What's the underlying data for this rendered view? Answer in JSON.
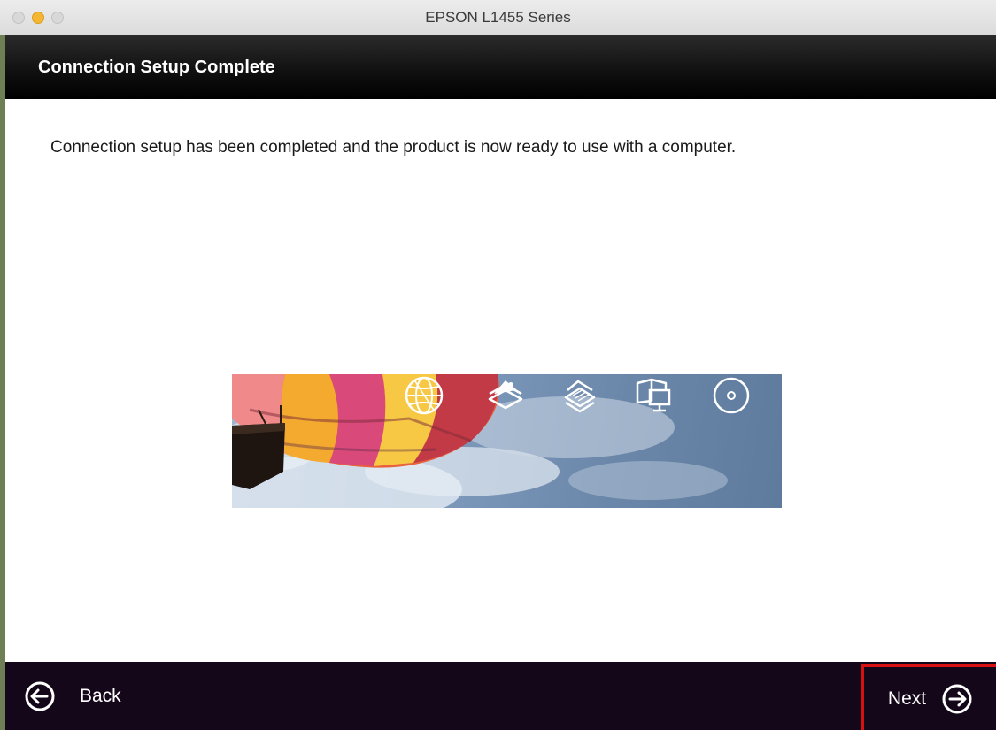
{
  "window": {
    "title": "EPSON L1455 Series"
  },
  "header": {
    "title": "Connection Setup Complete"
  },
  "content": {
    "message": "Connection setup has been completed and the product is now ready to use with a computer.",
    "banner_icons": [
      "globe-icon",
      "photo-stack-icon",
      "document-stack-icon",
      "book-monitor-icon",
      "disc-icon"
    ]
  },
  "footer": {
    "back_label": "Back",
    "next_label": "Next"
  },
  "colors": {
    "header_band": "#000000",
    "footer_band": "#15071a",
    "highlight_border": "#d81010",
    "minimize_light": "#f5b631"
  }
}
